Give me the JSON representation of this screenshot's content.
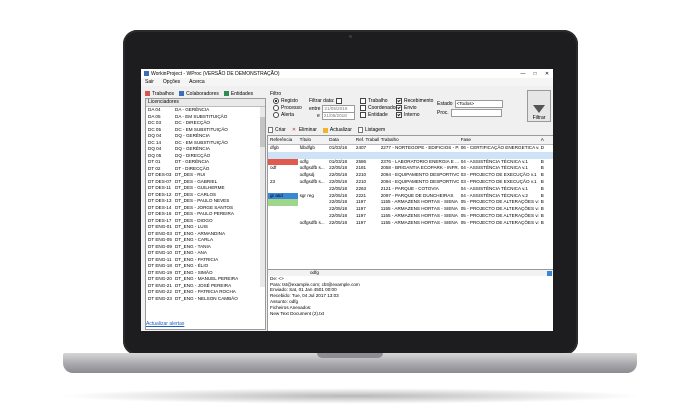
{
  "window": {
    "title": "WorkinProject - WProc (VERSÃO DE DEMONSTRAÇÃO)"
  },
  "menu": [
    "Sair",
    "Opções",
    "Acerca"
  ],
  "toolbar": [
    "Trabalhos",
    "Colaboradores",
    "Entidades"
  ],
  "left_panel": {
    "header": "Licenciadores",
    "rows": [
      [
        "DA 04",
        "DA - GERÊNCIA"
      ],
      [
        "DA 05",
        "DA - EM SUBSTITUIÇÃO"
      ],
      [
        "DC 03",
        "DC - DIRECÇÃO"
      ],
      [
        "DC 05",
        "DC - EM SUBSTITUIÇÃO"
      ],
      [
        "DQ 04",
        "DQ - GERÊNCIA"
      ],
      [
        "DC 14",
        "DC - EM SUBSTITUIÇÃO"
      ],
      [
        "DQ 04",
        "DQ - GERÊNCIA"
      ],
      [
        "DQ 05",
        "DQ - DIRECÇÃO"
      ],
      [
        "DT 01",
        "DT - GERÊNCIA"
      ],
      [
        "DT 02",
        "DT - DIRECÇÃO"
      ],
      [
        "DT DES-03",
        "DT_DES - RUI"
      ],
      [
        "DT DES-07",
        "DT_DES - GABRIEL"
      ],
      [
        "DT DES-11",
        "DT_DES - GUILHERME"
      ],
      [
        "DT DES-12",
        "DT_DES - CARLOS"
      ],
      [
        "DT DES-13",
        "DT_DES - PAULO NEVES"
      ],
      [
        "DT DES-14",
        "DT_DES - JORGE SANTOS"
      ],
      [
        "DT DES-16",
        "DT_DES - PAULO PEREIRA"
      ],
      [
        "DT DES-17",
        "DT_DES - DIOGO"
      ],
      [
        "DT ENG-01",
        "DT_ENG - LUIS"
      ],
      [
        "DT ENG-03",
        "DT_ENG - ARMANDINA"
      ],
      [
        "DT ENG-05",
        "DT_ENG - CARLA"
      ],
      [
        "DT ENG-09",
        "DT_ENG - TANIA"
      ],
      [
        "DT ENG-10",
        "DT_ENG - ANA"
      ],
      [
        "DT ENG-11",
        "DT_ENG - PATRICIA"
      ],
      [
        "DT ENG-18",
        "DT_ENG - ÉLIO"
      ],
      [
        "DT ENG-19",
        "DT_ENG - SIMÃO"
      ],
      [
        "DT ENG-20",
        "DT_ENG - MANUEL PEREIRA"
      ],
      [
        "DT ENG-21",
        "DT_ENG - JOSÉ PEREIRA"
      ],
      [
        "DT ENG-22",
        "DT_ENG - PATRICIA ROCHA"
      ],
      [
        "DT ENG-23",
        "DT_ENG - NELSON CAMBÃO"
      ]
    ],
    "refresh_link": "Actualizar alertas"
  },
  "filter": {
    "label": "Filtro",
    "radios": [
      "Registo",
      "Processo",
      "Alerta"
    ],
    "filtrar_data": "Filtrar data:",
    "entre": "entre",
    "e": "e",
    "date_from": "21/05/2016",
    "date_to": "21/05/2018",
    "checks_col1": [
      "Trabalho",
      "Coordenador",
      "Entidade"
    ],
    "checks_col2": [
      "Recebimento",
      "Envio",
      "Interno"
    ],
    "estado_label": "Estado",
    "estado_value": "<Todos>",
    "proc_label": "Proc.",
    "button": "Filtrar"
  },
  "actions": [
    "Criar",
    "Eliminar",
    "Actualizar",
    "Listagem"
  ],
  "grid": {
    "headers": [
      "Referência",
      "Título",
      "Data",
      "Ref. Trabalho",
      "Trabalho",
      "Fase",
      "A"
    ],
    "rows": [
      [
        "dfgb",
        "fdbdfgb",
        "01/03/18",
        "2407",
        "2277 - NORTEGOPE - EDIFICIOS - P...",
        "06 - CERTIFICAÇÃO ENERGETICA v.1",
        "D"
      ],
      [
        "",
        "",
        "",
        "",
        "",
        "",
        ""
      ],
      [
        "",
        "odfg",
        "01/03/18",
        "2586",
        "2376 - LABORATORIO ENERGIA E ...",
        "04 - ASSISTÊNCIA TÉCNICA v.1",
        "B"
      ],
      [
        "odf",
        "odfgsdfb s...",
        "22/05/18",
        "2181",
        "2058 - BRIGANTIA ECOPARK - INFR...",
        "04 - ASSISTÊNCIA TÉCNICA v.1",
        "B"
      ],
      [
        "",
        "odfgsdj",
        "22/05/18",
        "2210",
        "2094 - EQUIPAMENTO DESPORTIVO",
        "03 - PROJECTO DE EXECUÇÃO v.1",
        "B"
      ],
      [
        "23",
        "odfgsdfb s...",
        "22/05/18",
        "2210",
        "2094 - EQUIPAMENTO DESPORTIVO",
        "03 - PROJECTO DE EXECUÇÃO v.1",
        "B"
      ],
      [
        "",
        "",
        "22/05/18",
        "2263",
        "2121 - PARQUE - COTOVIA",
        "04 - ASSISTÊNCIA TÉCNICA v.1",
        "B"
      ],
      [
        "gr asd",
        "sgr reg",
        "22/05/18",
        "2221",
        "2097 - PARQUE DE DUNCHEIRAS",
        "04 - ASSISTÊNCIA TÉCNICA v.2",
        "B"
      ],
      [
        "",
        "",
        "22/05/18",
        "1197",
        "1155 - ARMAZENS HORTAS - SIENA",
        "05 - PROJECTO DE ALTERAÇÕES v.5",
        "B"
      ],
      [
        "",
        "",
        "22/05/18",
        "1197",
        "1155 - ARMAZENS HORTAS - SIENA",
        "05 - PROJECTO DE ALTERAÇÕES v.5",
        "B"
      ],
      [
        "",
        "",
        "22/05/18",
        "1197",
        "1155 - ARMAZENS HORTAS - SIENA",
        "05 - PROJECTO DE ALTERAÇÕES v.5",
        "B"
      ],
      [
        "",
        "odfgsdfb s...",
        "22/05/18",
        "1197",
        "1155 - ARMAZENS HORTAS - SIENA",
        "05 - PROJECTO DE ALTERAÇÕES v.5",
        "B"
      ]
    ]
  },
  "detail": {
    "title": "odfg",
    "lines": [
      "De:   <>",
      "Para:      tst@example.com; cbt@example.com",
      "Enviado:  Sat, 01 Jan 4501 00:00",
      "Recebido:       Tue, 04 Jul 2017 13:03",
      "Assunto:  odfg",
      "Ficheiros Anexados:",
      "  New Text Document (2).txt"
    ]
  },
  "colors": {
    "accent": "#3a6fb5",
    "selection": "#cfe3f6",
    "red": "#e05a4d",
    "green": "#9ed68b",
    "blue": "#3b87d6"
  }
}
